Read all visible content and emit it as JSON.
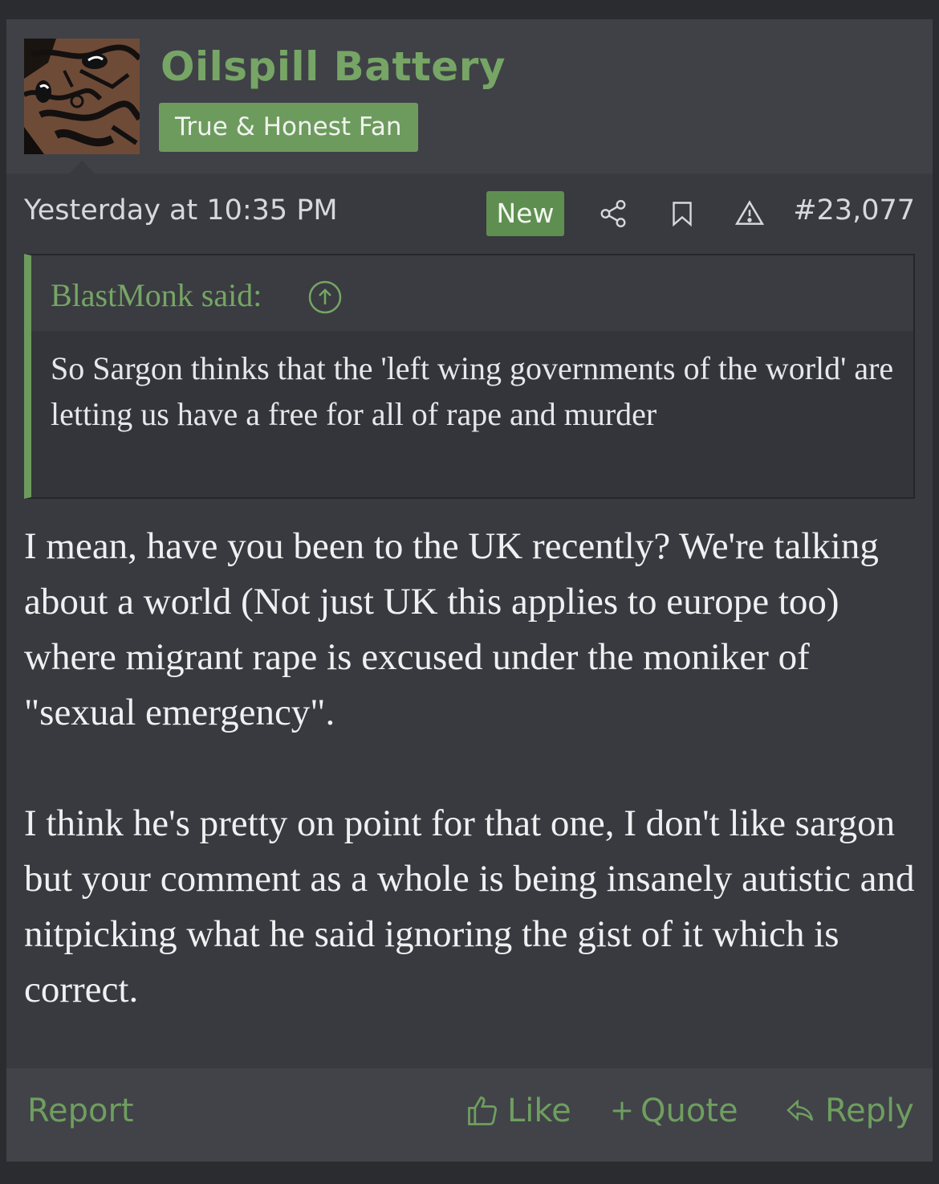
{
  "user": {
    "name": "Oilspill Battery",
    "title": "True & Honest Fan"
  },
  "attribution": {
    "timestamp": "Yesterday at 10:35 PM",
    "new_badge": "New",
    "post_number": "#23,077"
  },
  "quote": {
    "author_label": "BlastMonk said:",
    "text": "So Sargon thinks that the 'left wing governments of the world' are letting us have a free for all of rape and murder"
  },
  "message": {
    "paragraphs": [
      "I mean, have you been to the UK recently? We're talking about a world (Not just UK this applies to europe too) where migrant rape is excused under the moniker of \"sexual emergency\".",
      "I think he's pretty on point for that one, I don't like sargon but your comment as a whole is being insanely autistic and nitpicking what he said ignoring the gist of it which is correct."
    ]
  },
  "footer": {
    "report": "Report",
    "like": "Like",
    "quote": "Quote",
    "reply": "Reply"
  },
  "colors": {
    "accent": "#6d9b5e",
    "username": "#76a565",
    "background": "#383a3f",
    "header": "#3f4147"
  },
  "icons": [
    "share-icon",
    "bookmark-icon",
    "warning-icon",
    "quote-jump-up-icon",
    "thumbs-up-icon",
    "plus-icon",
    "reply-arrow-icon"
  ]
}
